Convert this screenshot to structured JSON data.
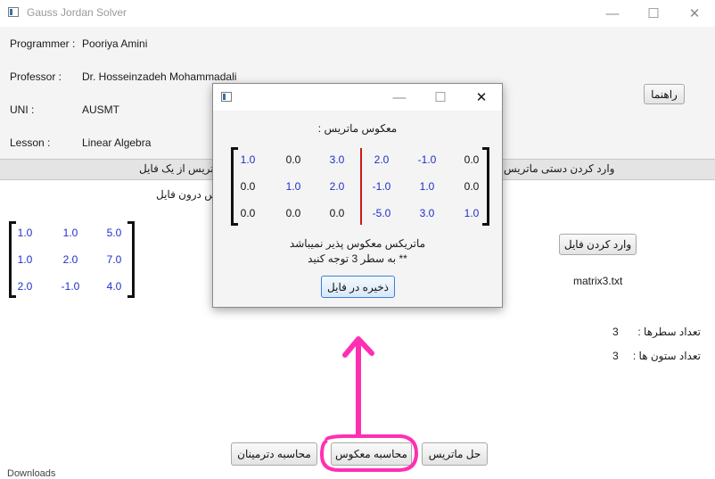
{
  "window": {
    "title": "Gauss Jordan Solver",
    "minimize": "—",
    "maximize": "☐",
    "close": "✕"
  },
  "info": {
    "programmer_label": "Programmer :",
    "programmer_value": "Pooriya Amini",
    "professor_label": "Professor :",
    "professor_value": "Dr. Hosseinzadeh Mohammadali",
    "uni_label": "UNI :",
    "uni_value": "AUSMT",
    "lesson_label": "Lesson :",
    "lesson_value": "Linear Algebra"
  },
  "help_button": "راهنما",
  "tabs": {
    "manual": "وارد کردن دستی ماتریس",
    "file": "وارد کردن ماتریس از یک فایل"
  },
  "file_section_label": "ماتریس درون فایل",
  "load_file_button": "وارد کردن فایل",
  "file_name": "matrix3.txt",
  "matrix": [
    [
      "1.0",
      "1.0",
      "5.0"
    ],
    [
      "1.0",
      "2.0",
      "7.0"
    ],
    [
      "2.0",
      "-1.0",
      "4.0"
    ]
  ],
  "rows_label": "تعداد سطرها :",
  "rows_value": "3",
  "cols_label": "تعداد ستون ها :",
  "cols_value": "3",
  "buttons": {
    "solve": "حل ماتریس",
    "inverse": "محاسبه معکوس",
    "determinant": "محاسبه دترمینان"
  },
  "dialog": {
    "minimize": "—",
    "maximize": "☐",
    "close": "✕",
    "heading": "معکوس ماتریس :",
    "left": [
      [
        "1.0",
        "0.0",
        "3.0"
      ],
      [
        "0.0",
        "1.0",
        "2.0"
      ],
      [
        "0.0",
        "0.0",
        "0.0"
      ]
    ],
    "right": [
      [
        "2.0",
        "-1.0",
        "0.0"
      ],
      [
        "-1.0",
        "1.0",
        "0.0"
      ],
      [
        "-5.0",
        "3.0",
        "1.0"
      ]
    ],
    "message_line1": "ماتریکس معکوس پذیر نمیباشد",
    "message_line2": "** به سطر 3 توجه کنید",
    "save_button": "ذخیره در فایل"
  },
  "partial_bottom_text": "Downloads",
  "colors": {
    "annotation": "#ff2fb3",
    "divider": "#cc1a1a",
    "blue_text": "#1f2fc8"
  }
}
